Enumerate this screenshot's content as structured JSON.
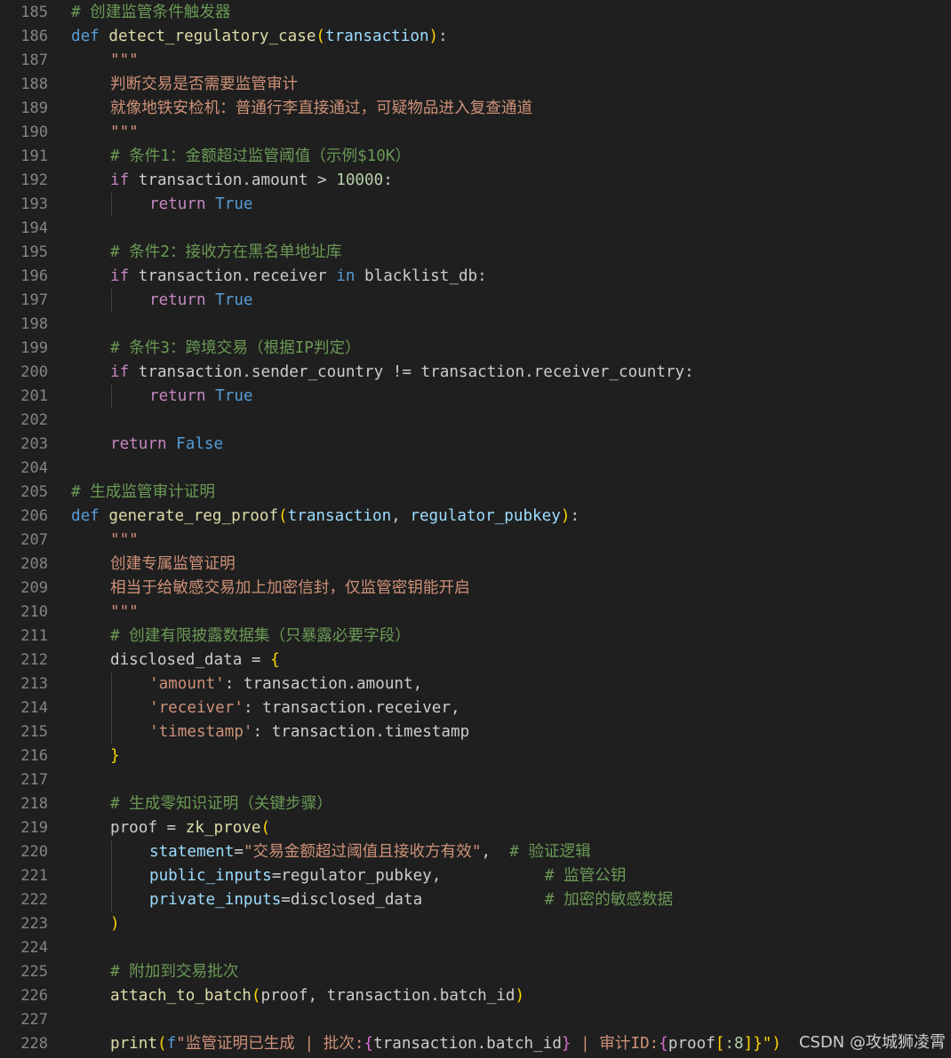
{
  "colors": {
    "background": "#1f1f1f",
    "line_number": "#858585",
    "comment": "#6a9955",
    "keyword": "#569cd6",
    "control": "#c586c0",
    "function": "#dcdcaa",
    "parameter": "#9cdcfe",
    "string": "#ce9178",
    "number": "#b5cea8",
    "bracket_gold": "#ffd700",
    "bracket_purple": "#da70d6",
    "plain": "#cccccc"
  },
  "watermark": "CSDN @攻城狮凌霄",
  "lines": [
    {
      "n": "185",
      "indent": 0,
      "tokens": [
        {
          "t": "# 创建监管条件触发器",
          "c": "cm"
        }
      ]
    },
    {
      "n": "186",
      "indent": 0,
      "tokens": [
        {
          "t": "def ",
          "c": "kw"
        },
        {
          "t": "detect_regulatory_case",
          "c": "fn"
        },
        {
          "t": "(",
          "c": "b1"
        },
        {
          "t": "transaction",
          "c": "prm"
        },
        {
          "t": ")",
          "c": "b1"
        },
        {
          "t": ":",
          "c": "pl"
        }
      ]
    },
    {
      "n": "187",
      "indent": 1,
      "tokens": [
        {
          "t": "\"\"\"",
          "c": "str"
        }
      ]
    },
    {
      "n": "188",
      "indent": 1,
      "tokens": [
        {
          "t": "判断交易是否需要监管审计",
          "c": "str"
        }
      ]
    },
    {
      "n": "189",
      "indent": 1,
      "tokens": [
        {
          "t": "就像地铁安检机：普通行李直接通过，可疑物品进入复查通道",
          "c": "str"
        }
      ]
    },
    {
      "n": "190",
      "indent": 1,
      "tokens": [
        {
          "t": "\"\"\"",
          "c": "str"
        }
      ]
    },
    {
      "n": "191",
      "indent": 1,
      "tokens": [
        {
          "t": "# 条件1：金额超过监管阈值（示例$10K）",
          "c": "cm"
        }
      ]
    },
    {
      "n": "192",
      "indent": 1,
      "tokens": [
        {
          "t": "if ",
          "c": "ctl"
        },
        {
          "t": "transaction.amount > ",
          "c": "pl"
        },
        {
          "t": "10000",
          "c": "num"
        },
        {
          "t": ":",
          "c": "pl"
        }
      ]
    },
    {
      "n": "193",
      "indent": 2,
      "tokens": [
        {
          "t": "return ",
          "c": "ctl"
        },
        {
          "t": "True",
          "c": "kw"
        }
      ]
    },
    {
      "n": "194",
      "indent": 0,
      "tokens": []
    },
    {
      "n": "195",
      "indent": 1,
      "tokens": [
        {
          "t": "# 条件2：接收方在黑名单地址库",
          "c": "cm"
        }
      ]
    },
    {
      "n": "196",
      "indent": 1,
      "tokens": [
        {
          "t": "if ",
          "c": "ctl"
        },
        {
          "t": "transaction.receiver ",
          "c": "pl"
        },
        {
          "t": "in ",
          "c": "kw"
        },
        {
          "t": "blacklist_db:",
          "c": "pl"
        }
      ]
    },
    {
      "n": "197",
      "indent": 2,
      "tokens": [
        {
          "t": "return ",
          "c": "ctl"
        },
        {
          "t": "True",
          "c": "kw"
        }
      ]
    },
    {
      "n": "198",
      "indent": 0,
      "tokens": []
    },
    {
      "n": "199",
      "indent": 1,
      "tokens": [
        {
          "t": "# 条件3：跨境交易（根据IP判定）",
          "c": "cm"
        }
      ]
    },
    {
      "n": "200",
      "indent": 1,
      "tokens": [
        {
          "t": "if ",
          "c": "ctl"
        },
        {
          "t": "transaction.sender_country != transaction.receiver_country:",
          "c": "pl"
        }
      ]
    },
    {
      "n": "201",
      "indent": 2,
      "tokens": [
        {
          "t": "return ",
          "c": "ctl"
        },
        {
          "t": "True",
          "c": "kw"
        }
      ]
    },
    {
      "n": "202",
      "indent": 0,
      "tokens": []
    },
    {
      "n": "203",
      "indent": 1,
      "tokens": [
        {
          "t": "return ",
          "c": "ctl"
        },
        {
          "t": "False",
          "c": "kw"
        }
      ]
    },
    {
      "n": "204",
      "indent": 0,
      "tokens": []
    },
    {
      "n": "205",
      "indent": 0,
      "tokens": [
        {
          "t": "# 生成监管审计证明",
          "c": "cm"
        }
      ]
    },
    {
      "n": "206",
      "indent": 0,
      "tokens": [
        {
          "t": "def ",
          "c": "kw"
        },
        {
          "t": "generate_reg_proof",
          "c": "fn"
        },
        {
          "t": "(",
          "c": "b1"
        },
        {
          "t": "transaction",
          "c": "prm"
        },
        {
          "t": ", ",
          "c": "pl"
        },
        {
          "t": "regulator_pubkey",
          "c": "prm"
        },
        {
          "t": ")",
          "c": "b1"
        },
        {
          "t": ":",
          "c": "pl"
        }
      ]
    },
    {
      "n": "207",
      "indent": 1,
      "tokens": [
        {
          "t": "\"\"\"",
          "c": "str"
        }
      ]
    },
    {
      "n": "208",
      "indent": 1,
      "tokens": [
        {
          "t": "创建专属监管证明",
          "c": "str"
        }
      ]
    },
    {
      "n": "209",
      "indent": 1,
      "tokens": [
        {
          "t": "相当于给敏感交易加上加密信封，仅监管密钥能开启",
          "c": "str"
        }
      ]
    },
    {
      "n": "210",
      "indent": 1,
      "tokens": [
        {
          "t": "\"\"\"",
          "c": "str"
        }
      ]
    },
    {
      "n": "211",
      "indent": 1,
      "tokens": [
        {
          "t": "# 创建有限披露数据集（只暴露必要字段）",
          "c": "cm"
        }
      ]
    },
    {
      "n": "212",
      "indent": 1,
      "tokens": [
        {
          "t": "disclosed_data = ",
          "c": "pl"
        },
        {
          "t": "{",
          "c": "b1"
        }
      ]
    },
    {
      "n": "213",
      "indent": 2,
      "tokens": [
        {
          "t": "'amount'",
          "c": "str"
        },
        {
          "t": ": transaction.amount,",
          "c": "pl"
        }
      ]
    },
    {
      "n": "214",
      "indent": 2,
      "tokens": [
        {
          "t": "'receiver'",
          "c": "str"
        },
        {
          "t": ": transaction.receiver,",
          "c": "pl"
        }
      ]
    },
    {
      "n": "215",
      "indent": 2,
      "tokens": [
        {
          "t": "'timestamp'",
          "c": "str"
        },
        {
          "t": ": transaction.timestamp",
          "c": "pl"
        }
      ]
    },
    {
      "n": "216",
      "indent": 1,
      "tokens": [
        {
          "t": "}",
          "c": "b1"
        }
      ]
    },
    {
      "n": "217",
      "indent": 0,
      "tokens": []
    },
    {
      "n": "218",
      "indent": 1,
      "tokens": [
        {
          "t": "# 生成零知识证明（关键步骤）",
          "c": "cm"
        }
      ]
    },
    {
      "n": "219",
      "indent": 1,
      "tokens": [
        {
          "t": "proof = ",
          "c": "pl"
        },
        {
          "t": "zk_prove",
          "c": "fn"
        },
        {
          "t": "(",
          "c": "b1"
        }
      ]
    },
    {
      "n": "220",
      "indent": 2,
      "tokens": [
        {
          "t": "statement",
          "c": "prm"
        },
        {
          "t": "=",
          "c": "pl"
        },
        {
          "t": "\"交易金额超过阈值且接收方有效\"",
          "c": "str"
        },
        {
          "t": ",  ",
          "c": "pl"
        },
        {
          "t": "# 验证逻辑",
          "c": "cm"
        }
      ]
    },
    {
      "n": "221",
      "indent": 2,
      "tokens": [
        {
          "t": "public_inputs",
          "c": "prm"
        },
        {
          "t": "=regulator_pubkey,           ",
          "c": "pl"
        },
        {
          "t": "# 监管公钥",
          "c": "cm"
        }
      ]
    },
    {
      "n": "222",
      "indent": 2,
      "tokens": [
        {
          "t": "private_inputs",
          "c": "prm"
        },
        {
          "t": "=disclosed_data             ",
          "c": "pl"
        },
        {
          "t": "# 加密的敏感数据",
          "c": "cm"
        }
      ]
    },
    {
      "n": "223",
      "indent": 1,
      "tokens": [
        {
          "t": ")",
          "c": "b1"
        }
      ]
    },
    {
      "n": "224",
      "indent": 0,
      "tokens": []
    },
    {
      "n": "225",
      "indent": 1,
      "tokens": [
        {
          "t": "# 附加到交易批次",
          "c": "cm"
        }
      ]
    },
    {
      "n": "226",
      "indent": 1,
      "tokens": [
        {
          "t": "attach_to_batch",
          "c": "fn"
        },
        {
          "t": "(",
          "c": "b1"
        },
        {
          "t": "proof, transaction.batch_id",
          "c": "pl"
        },
        {
          "t": ")",
          "c": "b1"
        }
      ]
    },
    {
      "n": "227",
      "indent": 0,
      "tokens": []
    },
    {
      "n": "228",
      "indent": 1,
      "tokens": [
        {
          "t": "print",
          "c": "fn"
        },
        {
          "t": "(",
          "c": "b1"
        },
        {
          "t": "f",
          "c": "kw"
        },
        {
          "t": "\"监管证明已生成 | 批次:",
          "c": "str"
        },
        {
          "t": "{",
          "c": "b2"
        },
        {
          "t": "transaction.batch_id",
          "c": "pl"
        },
        {
          "t": "}",
          "c": "b2"
        },
        {
          "t": " | 审计ID:",
          "c": "str"
        },
        {
          "t": "{",
          "c": "b2"
        },
        {
          "t": "proof",
          "c": "pl"
        },
        {
          "t": "[",
          "c": "b1"
        },
        {
          "t": ":8",
          "c": "num"
        },
        {
          "t": "]",
          "c": "b1"
        },
        {
          "t": "}\")",
          "c": "b1"
        }
      ]
    }
  ]
}
